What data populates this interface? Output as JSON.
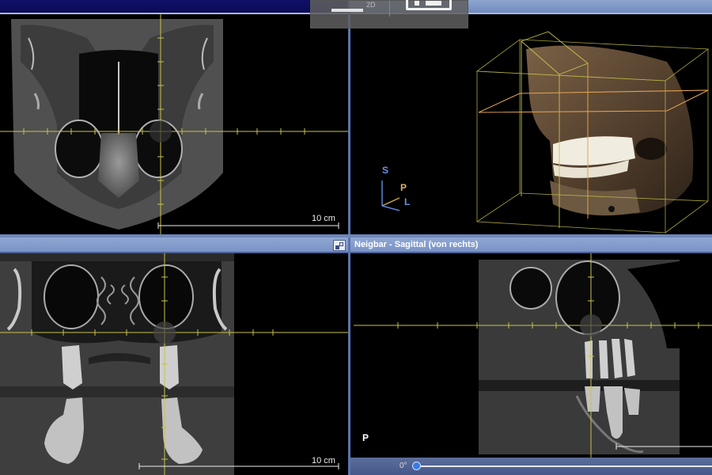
{
  "toolbar": {
    "view_2d_label": "2D"
  },
  "views": {
    "coronal": {
      "scale_label": "10 cm"
    },
    "volume_3d": {
      "axis_s": "S",
      "axis_p": "P",
      "axis_l": "L"
    },
    "axial": {
      "scale_label": "10 cm"
    },
    "sagittal": {
      "title": "Neigbar - Sagittal (von rechts)",
      "orient_label": "P"
    }
  },
  "slider": {
    "angle_label": "0°",
    "value_fraction": 0.0
  },
  "colors": {
    "crosshair": "#c8c24a",
    "header_dark": "#0a0a55",
    "header_light": "#7890c4",
    "bbox_orange": "#e0a050"
  }
}
